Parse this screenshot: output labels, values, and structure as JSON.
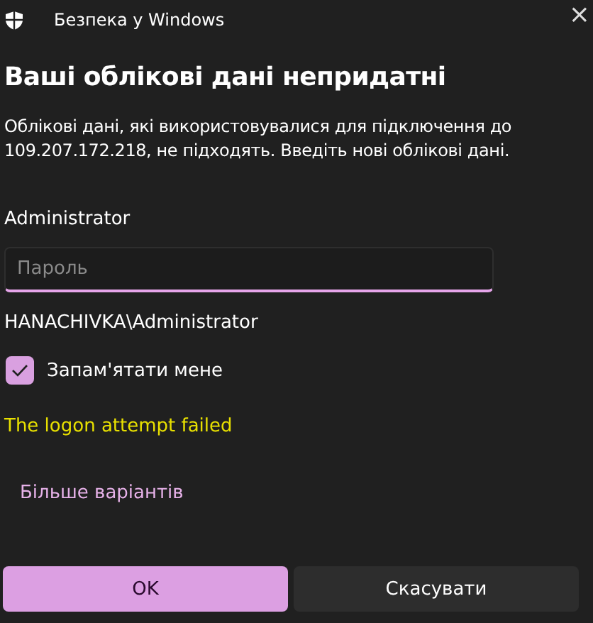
{
  "window": {
    "title": "Безпека у Windows",
    "close": "×"
  },
  "heading": "Ваші облікові дані непридатні",
  "message": "Облікові дані, які використовувалися для підключення до 109.207.172.218, не підходять. Введіть нові облікові дані.",
  "user": "Administrator",
  "password": {
    "placeholder": "Пароль"
  },
  "domain_user": "HANACHIVKA\\Administrator",
  "remember": {
    "label": "Запам'ятати мене",
    "checked": true
  },
  "error": "The logon attempt failed",
  "more_link": "Більше варіантів",
  "buttons": [
    {
      "label": "OK",
      "kind": "primary"
    },
    {
      "label": "Скасувати",
      "kind": "secondary"
    }
  ]
}
